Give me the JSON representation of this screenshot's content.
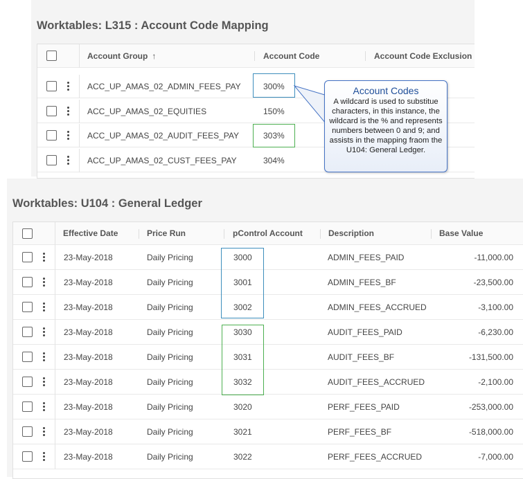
{
  "mapping": {
    "title": "Worktables: L315 : Account Code Mapping",
    "headers": {
      "account_group": "Account Group",
      "sort_arrow": "↑",
      "account_code": "Account Code",
      "account_code_exclusion": "Account Code Exclusion"
    },
    "rows": [
      {
        "account_group": "ACC_UP_AMAS_02_ADMIN_FEES_PAY",
        "account_code": "300%"
      },
      {
        "account_group": "ACC_UP_AMAS_02_EQUITIES",
        "account_code": "150%"
      },
      {
        "account_group": "ACC_UP_AMAS_02_AUDIT_FEES_PAY",
        "account_code": "303%"
      },
      {
        "account_group": "ACC_UP_AMAS_02_CUST_FEES_PAY",
        "account_code": "304%"
      }
    ]
  },
  "callout": {
    "title": "Account Codes",
    "body": "A wildcard is used to substitue characters, in this instance, the wildcard is the % and represents numbers between 0 and 9; and assists in the mapping fraom the U104: General Ledger."
  },
  "ledger": {
    "title": "Worktables: U104 : General Ledger",
    "headers": {
      "effective_date": "Effective Date",
      "price_run": "Price Run",
      "pcontrol_account": "pControl Account",
      "description": "Description",
      "base_value": "Base Value"
    },
    "rows": [
      {
        "effective_date": "23-May-2018",
        "price_run": "Daily Pricing",
        "pcontrol_account": "3000",
        "description": "ADMIN_FEES_PAID",
        "base_value": "-11,000.00"
      },
      {
        "effective_date": "23-May-2018",
        "price_run": "Daily Pricing",
        "pcontrol_account": "3001",
        "description": "ADMIN_FEES_BF",
        "base_value": "-23,500.00"
      },
      {
        "effective_date": "23-May-2018",
        "price_run": "Daily Pricing",
        "pcontrol_account": "3002",
        "description": "ADMIN_FEES_ACCRUED",
        "base_value": "-3,100.00"
      },
      {
        "effective_date": "23-May-2018",
        "price_run": "Daily Pricing",
        "pcontrol_account": "3030",
        "description": "AUDIT_FEES_PAID",
        "base_value": "-6,230.00"
      },
      {
        "effective_date": "23-May-2018",
        "price_run": "Daily Pricing",
        "pcontrol_account": "3031",
        "description": "AUDIT_FEES_BF",
        "base_value": "-131,500.00"
      },
      {
        "effective_date": "23-May-2018",
        "price_run": "Daily Pricing",
        "pcontrol_account": "3032",
        "description": "AUDIT_FEES_ACCRUED",
        "base_value": "-2,100.00"
      },
      {
        "effective_date": "23-May-2018",
        "price_run": "Daily Pricing",
        "pcontrol_account": "3020",
        "description": "PERF_FEES_PAID",
        "base_value": "-253,000.00"
      },
      {
        "effective_date": "23-May-2018",
        "price_run": "Daily Pricing",
        "pcontrol_account": "3021",
        "description": "PERF_FEES_BF",
        "base_value": "-518,000.00"
      },
      {
        "effective_date": "23-May-2018",
        "price_run": "Daily Pricing",
        "pcontrol_account": "3022",
        "description": "PERF_FEES_ACCRUED",
        "base_value": "-7,000.00"
      }
    ]
  },
  "colors": {
    "highlight_blue": "#3c8dbc",
    "highlight_green": "#4caf50",
    "callout_border": "#4472c4"
  }
}
